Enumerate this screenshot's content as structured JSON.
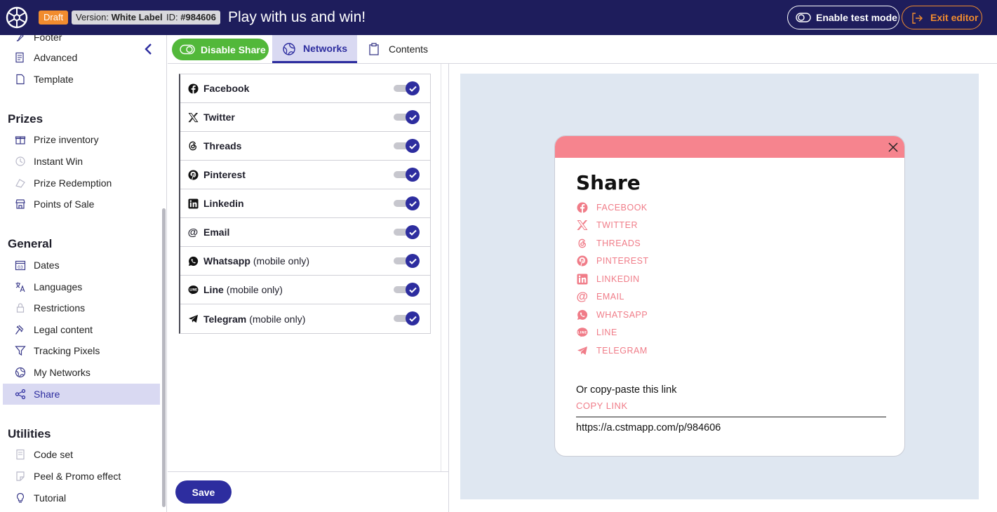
{
  "topbar": {
    "draft_label": "Draft",
    "version_prefix": "Version:",
    "version_value": "White Label",
    "id_prefix": "ID:",
    "id_value": "#984606",
    "title": "Play with us and win!",
    "test_mode_label": "Enable test mode",
    "exit_label": "Exit editor"
  },
  "sidebar": {
    "top_items": [
      {
        "label": "Footer",
        "icon": "brush-icon"
      },
      {
        "label": "Advanced",
        "icon": "document-settings-icon"
      },
      {
        "label": "Template",
        "icon": "file-icon"
      }
    ],
    "sections": [
      {
        "title": "Prizes",
        "items": [
          {
            "label": "Prize inventory",
            "icon": "gift-icon"
          },
          {
            "label": "Instant Win",
            "icon": "instant-win-icon"
          },
          {
            "label": "Prize Redemption",
            "icon": "redemption-icon"
          },
          {
            "label": "Points of Sale",
            "icon": "store-icon"
          }
        ]
      },
      {
        "title": "General",
        "items": [
          {
            "label": "Dates",
            "icon": "calendar-icon"
          },
          {
            "label": "Languages",
            "icon": "translate-icon"
          },
          {
            "label": "Restrictions",
            "icon": "lock-icon"
          },
          {
            "label": "Legal content",
            "icon": "gavel-icon"
          },
          {
            "label": "Tracking Pixels",
            "icon": "filter-icon"
          },
          {
            "label": "My Networks",
            "icon": "globe-icon"
          },
          {
            "label": "Share",
            "icon": "share-icon",
            "active": true
          }
        ]
      },
      {
        "title": "Utilities",
        "items": [
          {
            "label": "Code set",
            "icon": "code-set-icon"
          },
          {
            "label": "Peel & Promo effect",
            "icon": "peel-icon"
          },
          {
            "label": "Tutorial",
            "icon": "lightbulb-icon"
          }
        ]
      }
    ]
  },
  "tabs": {
    "disable_share": "Disable Share",
    "networks": "Networks",
    "contents": "Contents"
  },
  "networks": [
    {
      "name": "Facebook",
      "note": "",
      "enabled": true,
      "icon": "facebook-icon"
    },
    {
      "name": "Twitter",
      "note": "",
      "enabled": true,
      "icon": "x-twitter-icon"
    },
    {
      "name": "Threads",
      "note": "",
      "enabled": true,
      "icon": "threads-icon"
    },
    {
      "name": "Pinterest",
      "note": "",
      "enabled": true,
      "icon": "pinterest-icon"
    },
    {
      "name": "Linkedin",
      "note": "",
      "enabled": true,
      "icon": "linkedin-icon"
    },
    {
      "name": "Email",
      "note": "",
      "enabled": true,
      "icon": "at-icon"
    },
    {
      "name": "Whatsapp",
      "note": "(mobile only)",
      "enabled": true,
      "icon": "whatsapp-icon"
    },
    {
      "name": "Line",
      "note": "(mobile only)",
      "enabled": true,
      "icon": "line-icon"
    },
    {
      "name": "Telegram",
      "note": "(mobile only)",
      "enabled": true,
      "icon": "telegram-icon"
    }
  ],
  "save_label": "Save",
  "preview": {
    "title": "Share",
    "items": [
      "FACEBOOK",
      "TWITTER",
      "THREADS",
      "PINTEREST",
      "LINKEDIN",
      "EMAIL",
      "WHATSAPP",
      "LINE",
      "TELEGRAM"
    ],
    "copy_label": "Or copy-paste this link",
    "copy_link_label": "COPY LINK",
    "url": "https://a.cstmapp.com/p/984606"
  },
  "colors": {
    "topbar": "#1e1d5c",
    "primary": "#2d2d9f",
    "accent_orange": "#f18c2e",
    "green": "#52b83a",
    "preview_pink": "#f6848e"
  }
}
